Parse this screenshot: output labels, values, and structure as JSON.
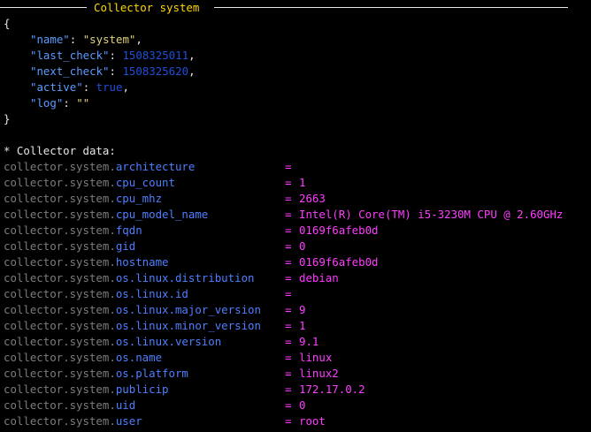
{
  "window": {
    "title": "Collector system"
  },
  "json_block": {
    "open_brace": "{",
    "close_brace": "}",
    "fields": [
      {
        "key": "\"name\"",
        "value": "\"system\"",
        "kind": "string",
        "trail": ","
      },
      {
        "key": "\"last_check\"",
        "value": "1508325011",
        "kind": "number",
        "trail": ","
      },
      {
        "key": "\"next_check\"",
        "value": "1508325620",
        "kind": "number",
        "trail": ","
      },
      {
        "key": "\"active\"",
        "value": "true",
        "kind": "bool",
        "trail": ","
      },
      {
        "key": "\"log\"",
        "value": "\"\"",
        "kind": "string",
        "trail": ""
      }
    ]
  },
  "collector_data": {
    "header": "* Collector data:",
    "prefix": "collector.system.",
    "rows": [
      {
        "key": "architecture",
        "value": ""
      },
      {
        "key": "cpu_count",
        "value": "1"
      },
      {
        "key": "cpu_mhz",
        "value": "2663"
      },
      {
        "key": "cpu_model_name",
        "value": "Intel(R) Core(TM) i5-3230M CPU @ 2.60GHz"
      },
      {
        "key": "fqdn",
        "value": "0169f6afeb0d"
      },
      {
        "key": "gid",
        "value": "0"
      },
      {
        "key": "hostname",
        "value": "0169f6afeb0d"
      },
      {
        "key": "os.linux.distribution",
        "value": "debian"
      },
      {
        "key": "os.linux.id",
        "value": ""
      },
      {
        "key": "os.linux.major_version",
        "value": "9"
      },
      {
        "key": "os.linux.minor_version",
        "value": "1"
      },
      {
        "key": "os.linux.version",
        "value": "9.1"
      },
      {
        "key": "os.name",
        "value": "linux"
      },
      {
        "key": "os.platform",
        "value": "linux2"
      },
      {
        "key": "publicip",
        "value": "172.17.0.2"
      },
      {
        "key": "uid",
        "value": "0"
      },
      {
        "key": "user",
        "value": "root"
      }
    ]
  },
  "colors": {
    "background": "#000000",
    "title": "#ffd700",
    "json_key": "#5c9cff",
    "json_string": "#e0d27a",
    "json_number": "#1f4fd9",
    "prefix": "#7c7c7c",
    "field": "#4f7fff",
    "value": "#ff3cff"
  }
}
